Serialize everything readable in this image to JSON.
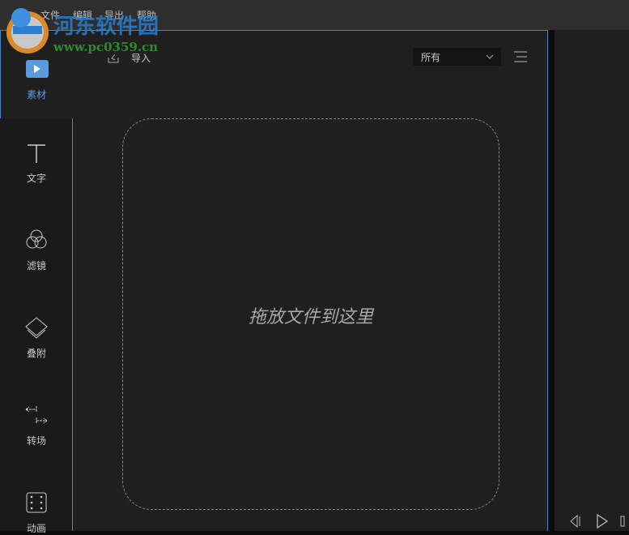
{
  "menu": [
    "文件",
    "编辑",
    "导出",
    "帮助"
  ],
  "watermark": {
    "name": "河东软件园",
    "url": "www.pc0359.cn"
  },
  "toolbar": {
    "import_label": "导入",
    "filter_value": "所有"
  },
  "sidebar": [
    {
      "label": "素材",
      "icon": "media-icon",
      "active": true
    },
    {
      "label": "文字",
      "icon": "text-icon"
    },
    {
      "label": "滤镜",
      "icon": "filter-icon"
    },
    {
      "label": "叠附",
      "icon": "overlay-icon"
    },
    {
      "label": "转场",
      "icon": "transition-icon"
    },
    {
      "label": "动画",
      "icon": "animation-icon"
    }
  ],
  "dropzone": {
    "text": "拖放文件到这里"
  },
  "colors": {
    "accent": "#4a86c5",
    "active_tab": "#5a9be0"
  }
}
